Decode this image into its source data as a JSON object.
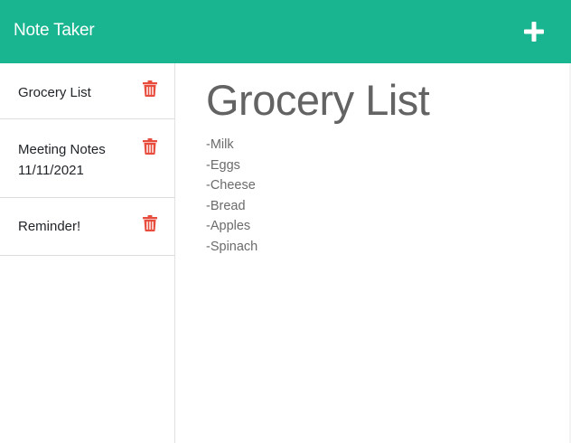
{
  "app": {
    "brand": "Note Taker"
  },
  "navbar": {
    "new_note_icon": "plus-icon"
  },
  "sidebar": {
    "notes": [
      {
        "title": "Grocery List",
        "delete_icon": "trash-icon"
      },
      {
        "title": "Meeting Notes 11/11/2021",
        "delete_icon": "trash-icon"
      },
      {
        "title": "Reminder!",
        "delete_icon": "trash-icon"
      }
    ]
  },
  "active_note": {
    "title": "Grocery List",
    "body": "-Milk\n-Eggs\n-Cheese\n-Bread\n-Apples\n-Spinach"
  },
  "colors": {
    "navbar": "#19b591",
    "delete_icon": "#e74c3c",
    "heading": "#636363"
  }
}
